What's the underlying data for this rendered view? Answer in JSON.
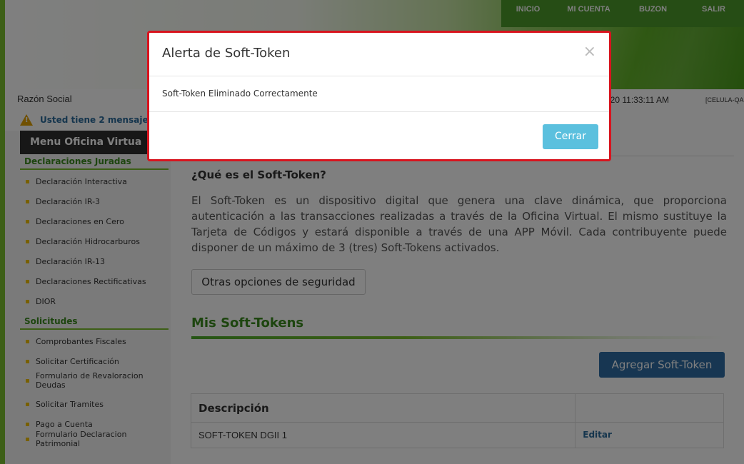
{
  "topnav": {
    "inicio": "INICIO",
    "mi_cuenta": "MI CUENTA",
    "buzon": "BUZON",
    "salir": "SALIR"
  },
  "info": {
    "razon_social": "Razón Social",
    "datetime": "020 11:33:11 AM",
    "user_tag": "[CELULA-QA"
  },
  "messages": {
    "text": "Usted tiene 2 mensaje"
  },
  "sidebar": {
    "menu_title": "Menu Oficina Virtua",
    "sections": [
      {
        "title": "Declaraciones Juradas"
      },
      {
        "title": "Solicitudes"
      }
    ],
    "items": [
      "Declaración Interactiva",
      "Declaración IR-3",
      "Declaraciones en Cero",
      "Declaración Hidrocarburos",
      "Declaración IR-13",
      "Declaraciones Rectificativas",
      "DIOR",
      "Comprobantes Fiscales",
      "Solicitar Certificación",
      "Formulario de Revaloracion Deudas",
      "Solicitar Tramites",
      "Pago a Cuenta",
      "Formulario Declaracion Patrimonial"
    ]
  },
  "content": {
    "heading": "¿Qué es el Soft-Token?",
    "paragraph": "El Soft-Token es un dispositivo digital que genera una clave dinámica, que proporciona autenticación a las transacciones realizadas a través de la Oficina Virtual. El mismo sustituye la Tarjeta de Códigos y estará disponible a través de una APP Móvil. Cada contribuyente puede disponer de un máximo de 3 (tres) Soft-Tokens activados.",
    "otras_button": "Otras opciones de seguridad",
    "mis_heading": "Mis Soft-Tokens",
    "agregar_button": "Agregar Soft-Token",
    "table": {
      "headers": [
        "Descripción",
        ""
      ],
      "rows": [
        {
          "descripcion": "SOFT-TOKEN DGII 1",
          "action": "Editar"
        }
      ]
    }
  },
  "modal": {
    "title": "Alerta de Soft-Token",
    "close_symbol": "×",
    "body": "Soft-Token Eliminado Correctamente",
    "cerrar_button": "Cerrar"
  },
  "colors": {
    "accent_green": "#4c9a2a",
    "modal_border": "#d8141e",
    "primary_button": "#2e6da4",
    "info_button": "#5bc0de"
  }
}
